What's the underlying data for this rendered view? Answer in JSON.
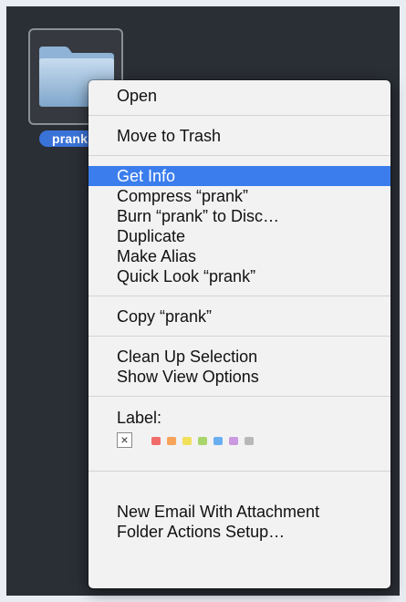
{
  "desktop": {
    "folder_name": "prank"
  },
  "menu": {
    "group1": [
      "Open"
    ],
    "group2": [
      "Move to Trash"
    ],
    "group3": [
      "Get Info",
      "Compress “prank”",
      "Burn “prank” to Disc…",
      "Duplicate",
      "Make Alias",
      "Quick Look “prank”"
    ],
    "group4": [
      "Copy “prank”"
    ],
    "group5": [
      "Clean Up Selection",
      "Show View Options"
    ],
    "label_heading": "Label:",
    "label_none_glyph": "×",
    "label_colors": [
      "#f26b6b",
      "#f7a35a",
      "#f0e05a",
      "#a9d66b",
      "#6aaef2",
      "#c99ae0",
      "#b8b8b8"
    ],
    "group6": [
      "New Email With Attachment",
      "Folder Actions Setup…"
    ],
    "selected_item": "Get Info",
    "selection_color": "#3b7ded"
  }
}
